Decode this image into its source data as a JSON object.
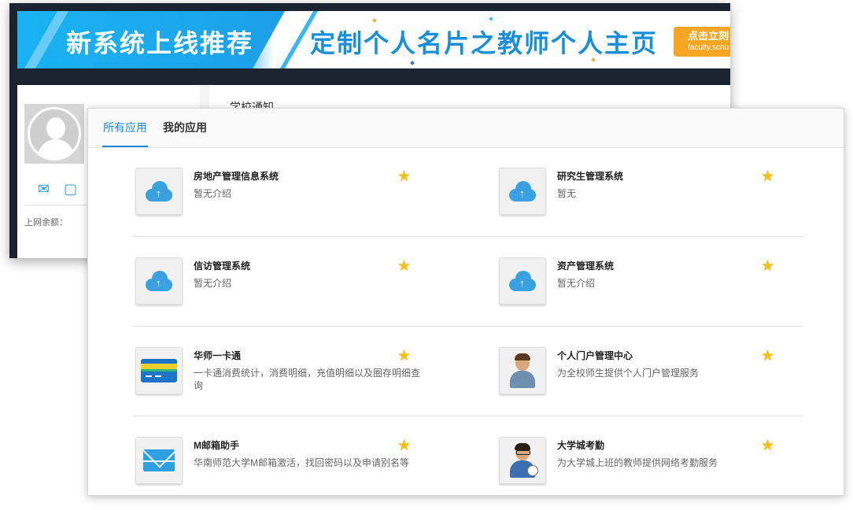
{
  "banner": {
    "title": "新系统上线推荐",
    "subtitle": "定制个人名片之教师个人主页",
    "cta_label": "点击立刻",
    "cta_url": "faculty.scnu"
  },
  "profile": {
    "net_balance_label": "上网余额："
  },
  "notice": {
    "title": "学校通知"
  },
  "tabs": [
    {
      "label": "所有应用",
      "active": true
    },
    {
      "label": "我的应用",
      "active": false
    }
  ],
  "apps": [
    {
      "name": "房地产管理信息系统",
      "desc": "暂无介绍",
      "icon": "cloud-upload-icon"
    },
    {
      "name": "研究生管理系统",
      "desc": "暂无",
      "icon": "cloud-upload-icon"
    },
    {
      "name": "信访管理系统",
      "desc": "暂无介绍",
      "icon": "cloud-upload-icon"
    },
    {
      "name": "资产管理系统",
      "desc": "暂无介绍",
      "icon": "cloud-upload-icon"
    },
    {
      "name": "华师一卡通",
      "desc": "一卡通消费统计，消费明细，充值明细以及圈存明细查询",
      "icon": "id-card-icon"
    },
    {
      "name": "个人门户管理中心",
      "desc": "为全校师生提供个人门户管理服务",
      "icon": "user-admin-icon"
    },
    {
      "name": "M邮箱助手",
      "desc": "华南师范大学M邮箱激活，找回密码以及申请别名等",
      "icon": "mail-icon"
    },
    {
      "name": "大学城考勤",
      "desc": "为大学城上班的教师提供网络考勤服务",
      "icon": "attendance-user-icon"
    }
  ],
  "colors": {
    "accent": "#1a8ad6",
    "star": "#f2c21b",
    "banner_blue": "#1fa6ea",
    "cta_orange": "#f6a623"
  }
}
